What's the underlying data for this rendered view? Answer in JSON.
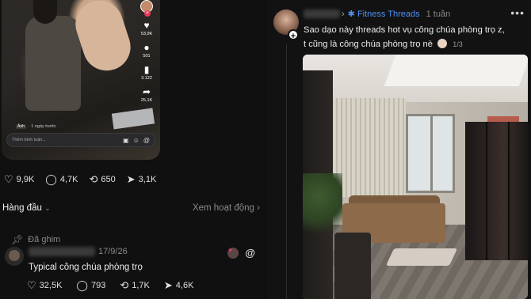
{
  "left_post": {
    "video": {
      "side_actions": [
        {
          "icon": "heart-icon",
          "glyph": "♥",
          "count": "53,9K"
        },
        {
          "icon": "comment-icon",
          "glyph": "●",
          "count": "501"
        },
        {
          "icon": "bookmark-icon",
          "glyph": "▮",
          "count": "3.122"
        },
        {
          "icon": "share-icon",
          "glyph": "➦",
          "count": "25,1K"
        }
      ],
      "meta_tag": "Ảnh",
      "meta_time": "· 1 ngày trước",
      "comment_placeholder": "Thêm bình luận..."
    },
    "stats": {
      "likes": "9,9K",
      "comments": "4,7K",
      "reposts": "650",
      "shares": "3,1K"
    },
    "sort": {
      "label": "Hàng đầu",
      "view_activity": "Xem hoạt động"
    },
    "pinned_label": "Đã ghim",
    "comment": {
      "date": "17/9/26",
      "text": "Typical công chúa phòng trọ",
      "likes": "32,5K",
      "replies": "793",
      "reposts": "1,7K",
      "shares": "4,6K"
    }
  },
  "right_post": {
    "group": "Fitness Threads",
    "time": "1 tuần",
    "text_line1": "Sao dạo này threads hot vụ công chúa phòng trọ z,",
    "text_line2": "t cũng là công chúa phòng trọ nè",
    "image_counter": "1/3",
    "more_label": "•••"
  },
  "colors": {
    "background": "#0f0f0f",
    "link_blue": "#4f8ff7",
    "muted": "#8a8a8a",
    "like_red": "#e8395b"
  }
}
